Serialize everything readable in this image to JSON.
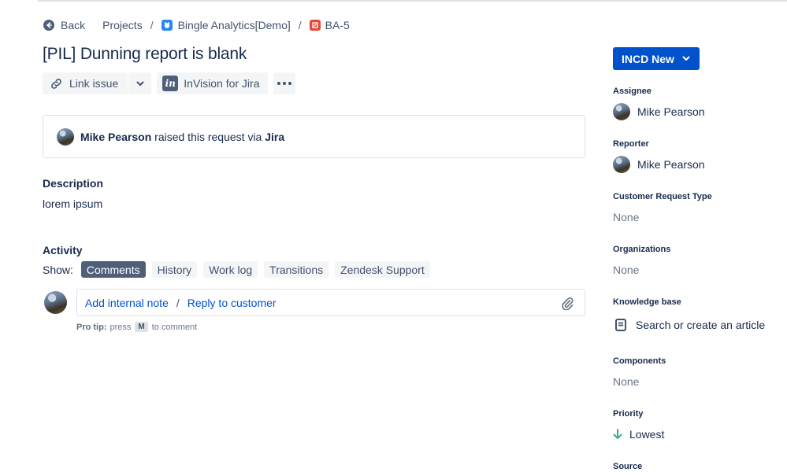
{
  "breadcrumb": {
    "back": "Back",
    "projects": "Projects",
    "separator": "/",
    "project": "Bingle Analytics[Demo]",
    "issue_key": "BA-5"
  },
  "issue": {
    "title": "[PIL] Dunning report is blank"
  },
  "toolbar": {
    "link_issue": "Link issue",
    "invision": "InVision for Jira"
  },
  "request": {
    "user": "Mike Pearson",
    "text": " raised this request via ",
    "channel": "Jira"
  },
  "description": {
    "heading": "Description",
    "body": "lorem ipsum"
  },
  "activity": {
    "heading": "Activity",
    "show_label": "Show:",
    "filters": [
      "Comments",
      "History",
      "Work log",
      "Transitions",
      "Zendesk Support"
    ],
    "active_filter": "Comments",
    "add_internal_note": "Add internal note",
    "separator": "/",
    "reply_to_customer": "Reply to customer",
    "protip_label": "Pro tip:",
    "protip_press": "press",
    "protip_key": "M",
    "protip_suffix": "to comment"
  },
  "sidebar": {
    "status": "INCD New",
    "assignee_label": "Assignee",
    "assignee": "Mike Pearson",
    "reporter_label": "Reporter",
    "reporter": "Mike Pearson",
    "request_type_label": "Customer Request Type",
    "request_type": "None",
    "organizations_label": "Organizations",
    "organizations": "None",
    "kb_label": "Knowledge base",
    "kb_action": "Search or create an article",
    "components_label": "Components",
    "components": "None",
    "priority_label": "Priority",
    "priority": "Lowest",
    "source_label": "Source"
  },
  "colors": {
    "primary": "#0052cc",
    "active_pill": "#505f79",
    "priority_lowest": "#36b37e",
    "project_icon": "#2684ff",
    "issue_type_icon": "#e5493a"
  }
}
